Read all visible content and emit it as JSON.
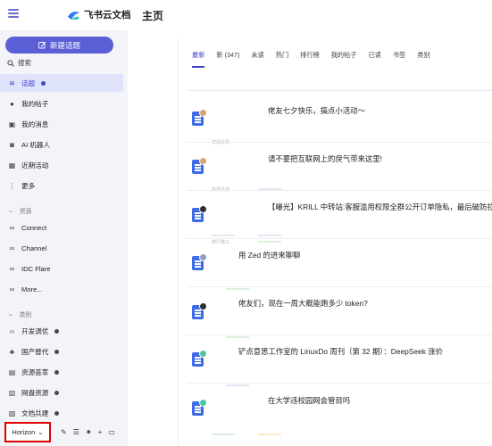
{
  "app": {
    "brand_name": "飞书云文档",
    "page_title": "主页"
  },
  "sidebar": {
    "new_topic_label": "新建话题",
    "search_label": "搜索",
    "items": [
      {
        "label": "话题",
        "icon": "layers-icon",
        "active": true
      },
      {
        "label": "我的帖子",
        "icon": "user-icon"
      },
      {
        "label": "我的消息",
        "icon": "inbox-icon"
      },
      {
        "label": "AI 机器人",
        "icon": "robot-icon"
      },
      {
        "label": "近期活动",
        "icon": "calendar-icon"
      },
      {
        "label": "更多",
        "icon": "more-icon"
      }
    ],
    "resources_heading": "资源",
    "resources": [
      {
        "label": "Connect",
        "icon": "link-icon"
      },
      {
        "label": "Channel",
        "icon": "link-icon"
      },
      {
        "label": "IDC Flare",
        "icon": "link-icon"
      },
      {
        "label": "More...",
        "icon": "infinity-icon"
      }
    ],
    "categories_heading": "类别",
    "categories": [
      {
        "label": "开发调优",
        "icon": "code-icon"
      },
      {
        "label": "国产替代",
        "icon": "plant-icon"
      },
      {
        "label": "资源荟萃",
        "icon": "box-icon"
      },
      {
        "label": "网盘资源",
        "icon": "cloud-icon"
      },
      {
        "label": "文档共建",
        "icon": "doc-icon"
      }
    ],
    "theme_label": "Horizon"
  },
  "tabs": [
    "最新",
    "新 (347)",
    "未读",
    "热门",
    "排行榜",
    "我的帖子",
    "已读",
    "书签",
    "类别"
  ],
  "topics": [
    "佬友七夕快乐，搞点小活动～",
    "请不要把互联网上的戾气带来这里!",
    "【曝光】KRILL 中转站:客服滥用权限全群公开订单隐私，最后破防拉黑",
    "用 Zed 的进来聊聊",
    "佬友们，现在一周大概能跑多少 token?",
    "铲点意思工作室的 LinuxDo 周刊（第 32 期）：DeepSeek 涨价",
    "在大学违校园网会管目吗"
  ],
  "faint_text": {
    "t1": "资源反馈",
    "t2": "资源反馈",
    "t3": "排行榜三"
  },
  "colors": {
    "accent": "#5b5fd6",
    "active_bg": "#dfe3fb",
    "doc_icon": "#3e6ce8",
    "highlight_border": "#e00000"
  }
}
